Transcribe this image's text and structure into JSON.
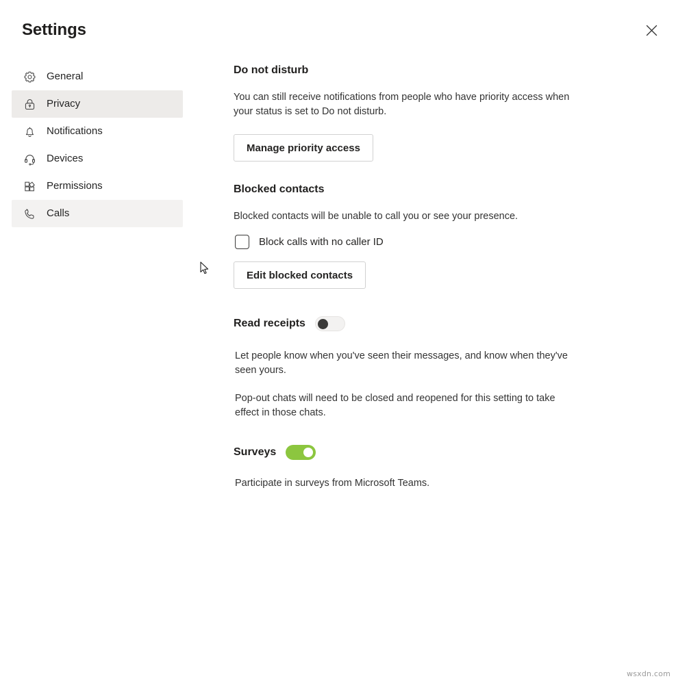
{
  "window": {
    "title": "Settings",
    "close_icon": "close-icon"
  },
  "sidebar": {
    "items": [
      {
        "label": "General",
        "icon": "gear-icon",
        "state": "default"
      },
      {
        "label": "Privacy",
        "icon": "lock-icon",
        "state": "selected"
      },
      {
        "label": "Notifications",
        "icon": "bell-icon",
        "state": "default"
      },
      {
        "label": "Devices",
        "icon": "headset-icon",
        "state": "default"
      },
      {
        "label": "Permissions",
        "icon": "permissions-icon",
        "state": "default"
      },
      {
        "label": "Calls",
        "icon": "phone-icon",
        "state": "hovered"
      }
    ]
  },
  "main": {
    "do_not_disturb": {
      "heading": "Do not disturb",
      "description": "You can still receive notifications from people who have priority access when your status is set to Do not disturb.",
      "button_label": "Manage priority access"
    },
    "blocked_contacts": {
      "heading": "Blocked contacts",
      "description": "Blocked contacts will be unable to call you or see your presence.",
      "checkbox_label": "Block calls with no caller ID",
      "checkbox_checked": false,
      "button_label": "Edit blocked contacts"
    },
    "read_receipts": {
      "heading": "Read receipts",
      "toggle_on": false,
      "description_1": "Let people know when you've seen their messages, and know when they've seen yours.",
      "description_2": "Pop-out chats will need to be closed and reopened for this setting to take effect in those chats."
    },
    "surveys": {
      "heading": "Surveys",
      "toggle_on": true,
      "description": "Participate in surveys from Microsoft Teams."
    }
  },
  "colors": {
    "toggle_on_track": "#8cc63f",
    "toggle_off_knob": "#3b3a39",
    "selected_nav_bg": "#edebe9",
    "hovered_nav_bg": "#f3f2f1"
  },
  "watermark": {
    "text": "wsxdn.com"
  }
}
